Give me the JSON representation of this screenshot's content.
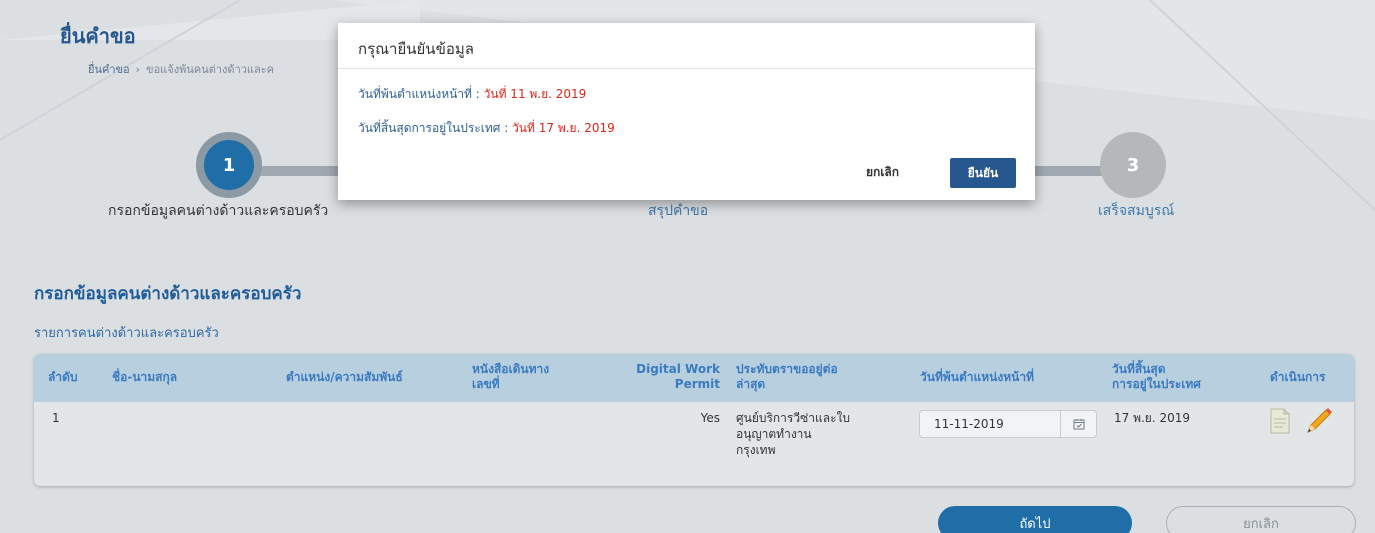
{
  "page": {
    "title": "ยื่นคำขอ",
    "breadcrumb": [
      "ยื่นคำขอ",
      "ขอแจ้งพ้นคนต่างด้าวและค"
    ]
  },
  "steps": [
    {
      "number": "1",
      "label": "กรอกข้อมูลคนต่างด้าวและครอบครัว"
    },
    {
      "number": "2",
      "label": "สรุปคำขอ"
    },
    {
      "number": "3",
      "label": "เสร็จสมบูรณ์"
    }
  ],
  "section": {
    "title": "กรอกข้อมูลคนต่างด้าวและครอบครัว",
    "subtitle": "รายการคนต่างด้าวและครอบครัว"
  },
  "table": {
    "headers": {
      "no": "ลำดับ",
      "name": "ชื่อ-นามสกุล",
      "position": "ตำแหน่ง/ความสัมพันธ์",
      "passport": [
        "หนังสือเดินทาง",
        "เลขที่"
      ],
      "permit": [
        "Digital Work",
        "Permit"
      ],
      "visa": [
        "ประทับตราขออยู่ต่อ",
        "ล่าสุด"
      ],
      "leave_date": "วันที่พ้นตำแหน่งหน้าที่",
      "end_stay": [
        "วันที่สิ้นสุด",
        "การอยู่ในประเทศ"
      ],
      "actions": "ดำเนินการ"
    },
    "row": {
      "no": "1",
      "permit": "Yes",
      "visa": [
        "ศูนย์บริการวีซ่าและใบ",
        "อนุญาตทำงาน",
        "กรุงเทพ"
      ],
      "leave_date_value": "11-11-2019",
      "end_stay": "17 พ.ย. 2019"
    }
  },
  "buttons": {
    "next": "ถัดไป",
    "cancel": "ยกเลิก"
  },
  "modal": {
    "title": "กรุณายืนยันข้อมูล",
    "row1_label": "วันที่พ้นตำแหน่งหน้าที่ : ",
    "row1_value": "วันที่ 11 พ.ย. 2019",
    "row2_label": "วันที่สิ้นสุดการอยู่ในประเทศ : ",
    "row2_value": "วันที่ 17 พ.ย. 2019",
    "cancel": "ยกเลิก",
    "confirm": "ยืนยัน"
  },
  "colors": {
    "primary": "#1f6ea7",
    "modal_value": "#e0241b",
    "heading": "#27578f"
  }
}
